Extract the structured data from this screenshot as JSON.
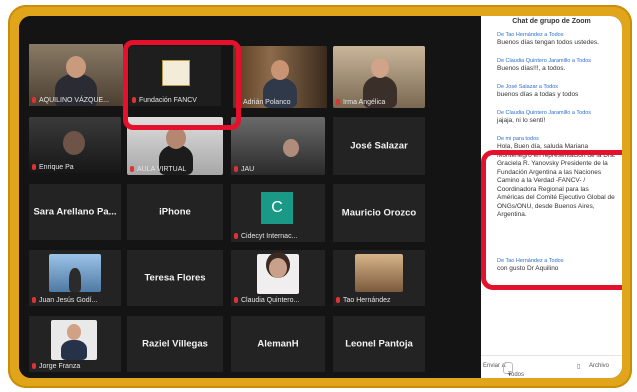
{
  "chat": {
    "title": "Chat de grupo de Zoom",
    "messages": [
      {
        "from": "De Tao Hernández a Todos",
        "text": "Buenos días tengan todos ustedes."
      },
      {
        "from": "De Claudia Quintero Jaramillo a Todos",
        "text": "Buenos días!!!, a todos."
      },
      {
        "from": "De José Salazar a Todos",
        "text": "buenos días a todas y todos"
      },
      {
        "from": "De Claudia Quintero Jaramillo a Todos",
        "text": "jajaja, ni lo sentí!"
      },
      {
        "from": "De mi para todos",
        "text": "Hola, Buen día, saluda Mariana Montenegro en representación de la Dra. Graciela R. Yanovsky Presidente de la Fundación Argentina a las Naciones Camino a la Verdad -FANCV- / Coordinadora Regional para las Américas del Comité Ejecutivo Global de ONGs/ONU, desde Buenos Aires, Argentina."
      },
      {
        "from": "De Tao Hernández a Todos",
        "text": "con gusto Dr Aquilino"
      }
    ],
    "send_to_label": "Enviar a:",
    "send_to_value": "Todos",
    "archive_label": "Archivo"
  },
  "participants": [
    {
      "name": "AQUILINO VÁZQUE...",
      "kind": "video"
    },
    {
      "name": "Fundación FANCV",
      "kind": "logo"
    },
    {
      "name": "Adrián Polanco",
      "kind": "video"
    },
    {
      "name": "Irma Angélica",
      "kind": "video"
    },
    {
      "name": "Enrique Pa",
      "kind": "video"
    },
    {
      "name": "AULA VIRTUAL",
      "kind": "video"
    },
    {
      "name": "JAU",
      "kind": "video"
    },
    {
      "name": "José Salazar",
      "kind": "name"
    },
    {
      "name": "Sara Arellano Pa...",
      "kind": "name"
    },
    {
      "name": "iPhone",
      "kind": "name"
    },
    {
      "name": "Cidecyt Internac...",
      "kind": "avatar",
      "initial": "C"
    },
    {
      "name": "Mauricio Orozco",
      "kind": "name"
    },
    {
      "name": "Juan Jesús Godí...",
      "kind": "video"
    },
    {
      "name": "Teresa Flores",
      "kind": "name"
    },
    {
      "name": "Claudia Quintero...",
      "kind": "video"
    },
    {
      "name": "Tao Hernández",
      "kind": "video"
    },
    {
      "name": "Jorge Franza",
      "kind": "video"
    },
    {
      "name": "Raziel Villegas",
      "kind": "name"
    },
    {
      "name": "AlemanH",
      "kind": "name"
    },
    {
      "name": "Leonel Pantoja",
      "kind": "name"
    }
  ],
  "colors": {
    "frame": "#e0a51a",
    "highlight": "#e5102b",
    "avatar_teal": "#1a9a86",
    "link": "#2d6ecf"
  }
}
